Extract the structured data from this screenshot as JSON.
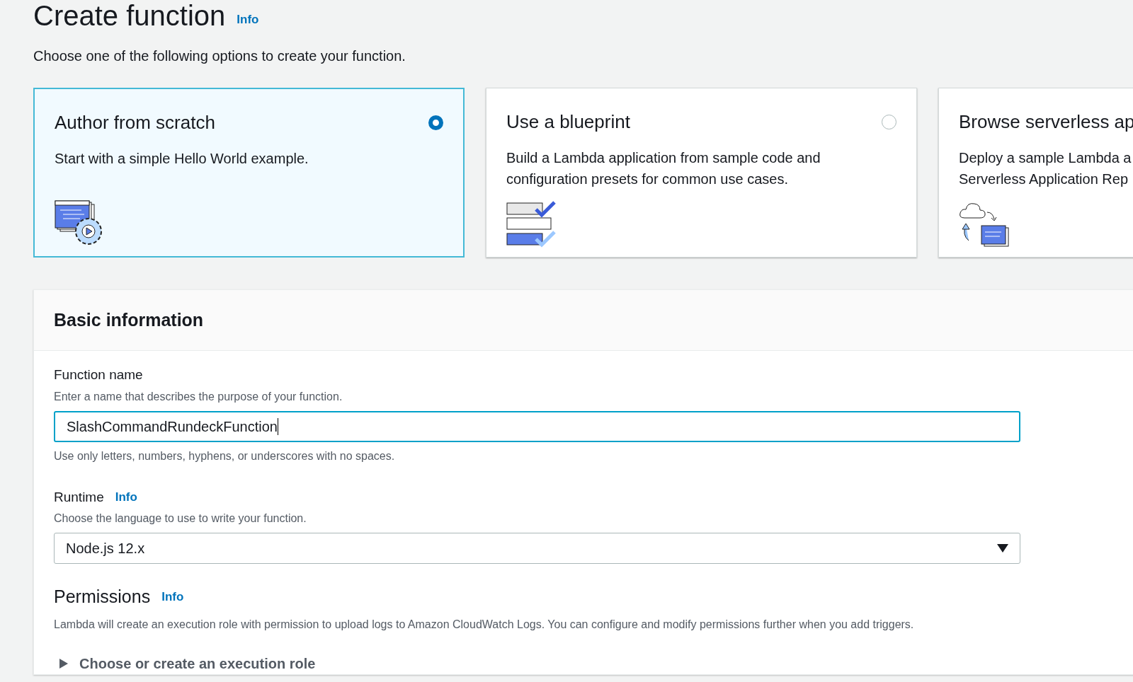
{
  "page": {
    "title": "Create function",
    "info_link": "Info",
    "subtitle": "Choose one of the following options to create your function."
  },
  "options": [
    {
      "kind": "scratch",
      "title": "Author from scratch",
      "lines": [
        "Start with a simple Hello World example."
      ],
      "selected": true,
      "radio_visible": true
    },
    {
      "kind": "blueprint",
      "title": "Use a blueprint",
      "lines": [
        "Build a Lambda application from sample code and",
        "configuration presets for common use cases."
      ],
      "selected": false,
      "radio_visible": true
    },
    {
      "kind": "serverless",
      "title": "Browse serverless ap",
      "lines": [
        "Deploy a sample Lambda a",
        "Serverless Application Rep"
      ],
      "selected": false,
      "radio_visible": false
    }
  ],
  "basic_information": {
    "title": "Basic information",
    "function_name": {
      "label": "Function name",
      "description": "Enter a name that describes the purpose of your function.",
      "value": "SlashCommandRundeckFunction",
      "constraint": "Use only letters, numbers, hyphens, or underscores with no spaces."
    },
    "runtime": {
      "label": "Runtime",
      "info_link": "Info",
      "description": "Choose the language to use to write your function.",
      "value": "Node.js 12.x"
    },
    "permissions": {
      "label": "Permissions",
      "info_link": "Info",
      "description": "Lambda will create an execution role with permission to upload logs to Amazon CloudWatch Logs. You can configure and modify permissions further when you add triggers.",
      "expander": {
        "label": "Choose or create an execution role",
        "expanded": false
      }
    }
  }
}
